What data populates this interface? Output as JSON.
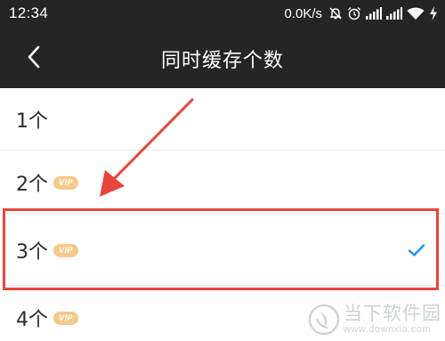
{
  "status_bar": {
    "time": "12:34",
    "net_speed": "0.0K/s",
    "icons": [
      "mute-bell-icon",
      "alarm-icon",
      "signal-icon",
      "signal-icon",
      "wifi-icon",
      "charging-icon"
    ]
  },
  "header": {
    "back_icon": "chevron-left-icon",
    "title": "同时缓存个数"
  },
  "options": [
    {
      "label": "1个",
      "vip": false,
      "selected": false
    },
    {
      "label": "2个",
      "vip": true,
      "badge": "VIP",
      "selected": false
    },
    {
      "label": "3个",
      "vip": true,
      "badge": "VIP",
      "selected": true
    },
    {
      "label": "4个",
      "vip": true,
      "badge": "VIP",
      "selected": false
    }
  ],
  "colors": {
    "header_bg": "#252526",
    "check": "#1e90ff",
    "vip_badge": "#f4c98a",
    "annotation": "#e8453c"
  },
  "watermark": {
    "name": "当下软件园",
    "url": "www.downxia.com"
  }
}
